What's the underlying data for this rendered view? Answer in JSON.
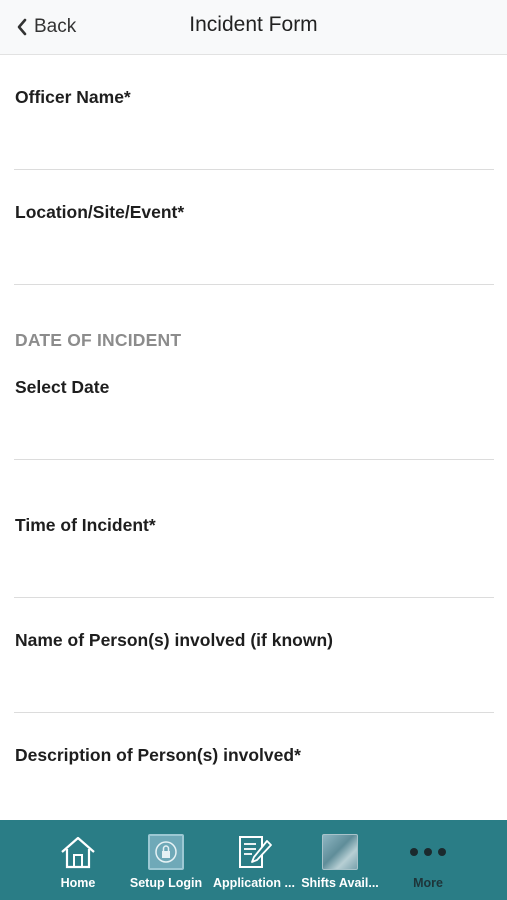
{
  "navbar": {
    "back_label": "Back",
    "title": "Incident Form"
  },
  "form": {
    "officer_name_label": "Officer Name*",
    "location_label": "Location/Site/Event*",
    "date_section_header": "DATE OF INCIDENT",
    "select_date_label": "Select Date",
    "time_label": "Time of Incident*",
    "persons_name_label": "Name of Person(s) involved (if known)",
    "persons_description_label": "Description of Person(s) involved*"
  },
  "tabbar": {
    "background": "#2a7d86",
    "tabs": [
      {
        "label": "Home",
        "icon": "home-icon"
      },
      {
        "label": "Setup Login",
        "icon": "setup-login-thumbnail"
      },
      {
        "label": "Application ...",
        "icon": "application-form-icon"
      },
      {
        "label": "Shifts Avail...",
        "icon": "shifts-thumbnail"
      },
      {
        "label": "More",
        "icon": "more-dots-icon"
      }
    ]
  }
}
